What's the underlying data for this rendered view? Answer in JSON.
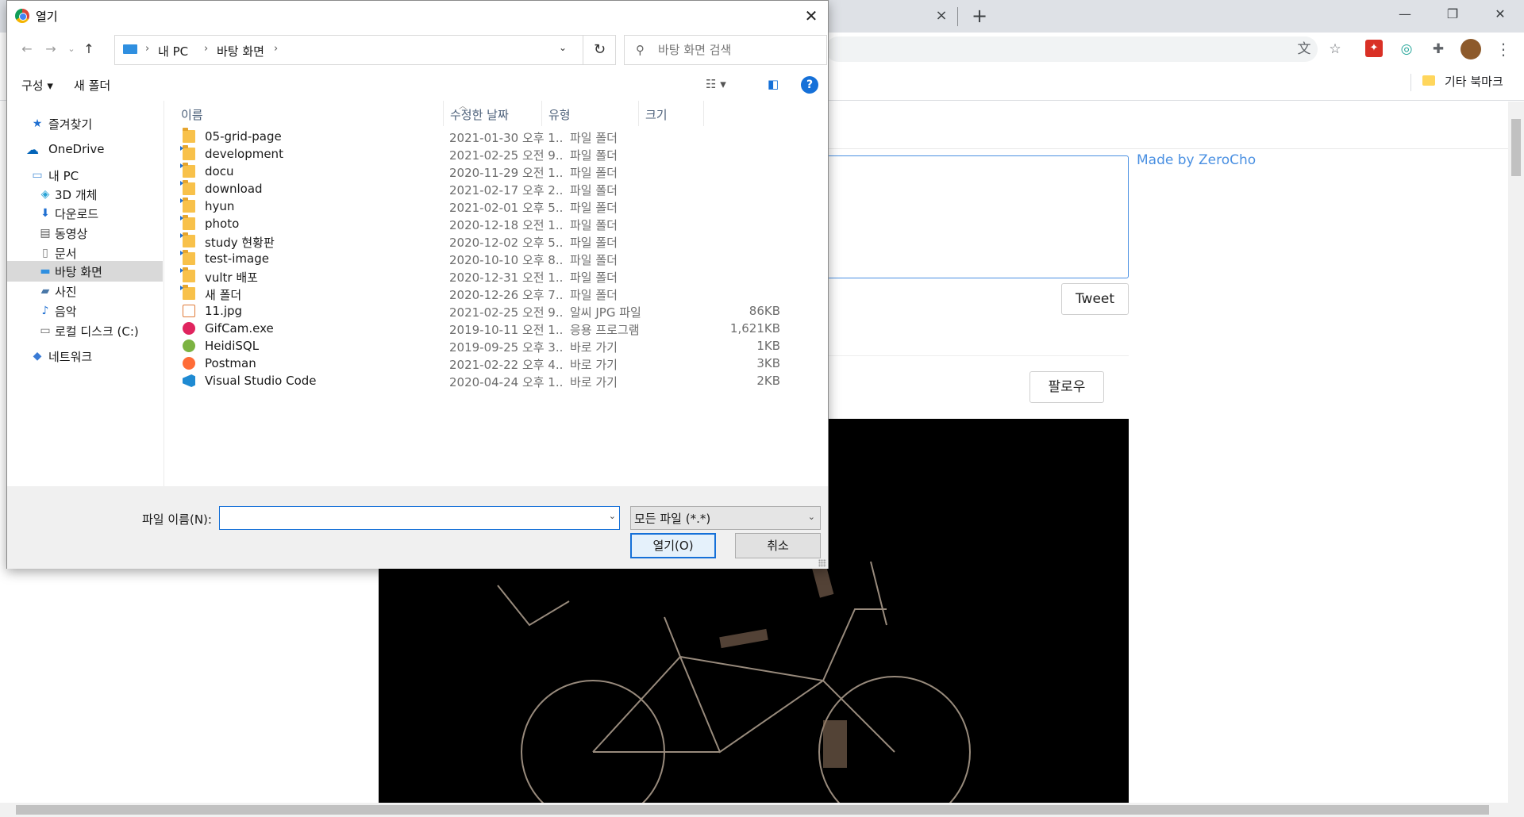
{
  "browser": {
    "tab_close": "×",
    "new_tab": "+",
    "window_buttons": {
      "minimize": "—",
      "restore": "❐",
      "close": "✕"
    },
    "bookmark_folder_label": "기타 북마크",
    "page": {
      "made_by": "Made by ZeroCho",
      "tweet_button": "Tweet",
      "follow_button": "팔로우"
    }
  },
  "dialog": {
    "title": "열기",
    "close_glyph": "✕",
    "breadcrumbs": [
      "내 PC",
      "바탕 화면"
    ],
    "search_placeholder": "바탕 화면 검색",
    "commands": {
      "organize": "구성 ▾",
      "new_folder": "새 폴더"
    },
    "tree": [
      {
        "label": "즐겨찾기",
        "icon": "star-icon"
      },
      {
        "label": "OneDrive",
        "icon": "cloud-icon"
      },
      {
        "label": "내 PC",
        "icon": "computer-icon"
      },
      {
        "label": "3D 개체",
        "icon": "cube-icon"
      },
      {
        "label": "다운로드",
        "icon": "download-icon"
      },
      {
        "label": "동영상",
        "icon": "video-icon"
      },
      {
        "label": "문서",
        "icon": "document-icon"
      },
      {
        "label": "바탕 화면",
        "icon": "desktop-icon",
        "selected": true
      },
      {
        "label": "사진",
        "icon": "picture-icon"
      },
      {
        "label": "음악",
        "icon": "music-icon"
      },
      {
        "label": "로컬 디스크 (C:)",
        "icon": "disk-icon"
      },
      {
        "label": "네트워크",
        "icon": "network-icon"
      }
    ],
    "columns": {
      "name": "이름",
      "date": "수정한 날짜",
      "type": "유형",
      "size": "크기"
    },
    "files": [
      {
        "name": "05-grid-page",
        "date": "2021-01-30 오후 1...",
        "type": "파일 폴더",
        "size": "",
        "kind": "folder"
      },
      {
        "name": "development",
        "date": "2021-02-25 오전 9...",
        "type": "파일 폴더",
        "size": "",
        "kind": "folder-link"
      },
      {
        "name": "docu",
        "date": "2020-11-29 오전 1...",
        "type": "파일 폴더",
        "size": "",
        "kind": "folder-link"
      },
      {
        "name": "download",
        "date": "2021-02-17 오후 2...",
        "type": "파일 폴더",
        "size": "",
        "kind": "folder-link"
      },
      {
        "name": "hyun",
        "date": "2021-02-01 오후 5...",
        "type": "파일 폴더",
        "size": "",
        "kind": "folder-link"
      },
      {
        "name": "photo",
        "date": "2020-12-18 오전 1...",
        "type": "파일 폴더",
        "size": "",
        "kind": "folder-link"
      },
      {
        "name": "study 현황판",
        "date": "2020-12-02 오후 5...",
        "type": "파일 폴더",
        "size": "",
        "kind": "folder-link"
      },
      {
        "name": "test-image",
        "date": "2020-10-10 오후 8...",
        "type": "파일 폴더",
        "size": "",
        "kind": "folder-link"
      },
      {
        "name": "vultr 배포",
        "date": "2020-12-31 오전 1...",
        "type": "파일 폴더",
        "size": "",
        "kind": "folder-link"
      },
      {
        "name": "새 폴더",
        "date": "2020-12-26 오후 7...",
        "type": "파일 폴더",
        "size": "",
        "kind": "folder-link"
      },
      {
        "name": "11.jpg",
        "date": "2021-02-25 오전 9...",
        "type": "알씨 JPG 파일",
        "size": "86KB",
        "kind": "image"
      },
      {
        "name": "GifCam.exe",
        "date": "2019-10-11 오전 1...",
        "type": "응용 프로그램",
        "size": "1,621KB",
        "kind": "exe"
      },
      {
        "name": "HeidiSQL",
        "date": "2019-09-25 오후 3...",
        "type": "바로 가기",
        "size": "1KB",
        "kind": "heidisql"
      },
      {
        "name": "Postman",
        "date": "2021-02-22 오후 4...",
        "type": "바로 가기",
        "size": "3KB",
        "kind": "postman"
      },
      {
        "name": "Visual Studio Code",
        "date": "2020-04-24 오후 1...",
        "type": "바로 가기",
        "size": "2KB",
        "kind": "vscode"
      }
    ],
    "filename_label": "파일 이름(N):",
    "filename_value": "",
    "filetype_selected": "모든 파일 (*.*)",
    "open_button": "열기(O)",
    "cancel_button": "취소"
  }
}
